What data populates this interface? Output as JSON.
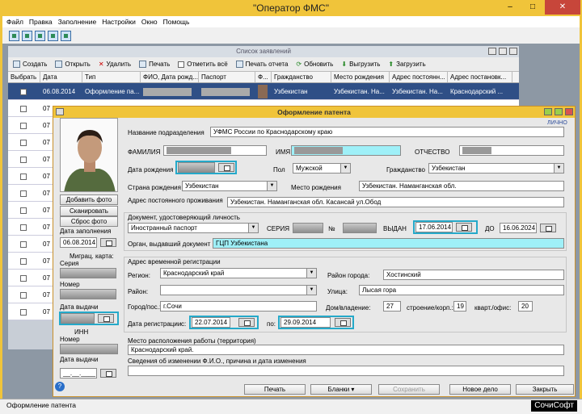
{
  "window": {
    "title": "\"Оператор ФМС\""
  },
  "menu": [
    "Файл",
    "Правка",
    "Заполнение",
    "Настройки",
    "Окно",
    "Помощь"
  ],
  "list_window": {
    "title": "Список заявлений",
    "toolbar": [
      "Создать",
      "Открыть",
      "Удалить",
      "Печать",
      "Отметить всё",
      "Печать отчета",
      "Обновить",
      "Выгрузить",
      "Загрузить"
    ],
    "columns": [
      "Выбрать",
      "Дата",
      "Тип",
      "ФИО, Дата рожд...",
      "Паспорт",
      "Ф...",
      "Гражданство",
      "Место рождения",
      "Адрес постоянн...",
      "Адрес постановк..."
    ],
    "first_row": {
      "date": "06.08.2014",
      "type": "Оформление па...",
      "citizenship": "Узбекистан",
      "birth_place": "Узбекистан. На...",
      "address": "Узбекистан. На...",
      "reg_address": "Краснодарский ..."
    },
    "row_dates": [
      "07",
      "07",
      "07",
      "07",
      "07",
      "07",
      "07",
      "07",
      "07",
      "07",
      "07",
      "07",
      "07"
    ]
  },
  "dialog": {
    "title": "Оформление патента",
    "corner": "ЛИЧНО",
    "left": {
      "add_photo": "Добавить фото",
      "scan": "Сканировать",
      "reset_photo": "Сброс фото",
      "fill_date_label": "Дата заполнения",
      "fill_date": "06.08.2014",
      "migr_card": "Миграц. карта:",
      "series": "Серия",
      "number": "Номер",
      "issue_date": "Дата выдачи",
      "inn": "ИНН",
      "inn_number": "Номер",
      "inn_date": "Дата выдачи",
      "date_mask": "__.__.____"
    },
    "dept_label": "Название подразделения",
    "dept": "УФМС России по Краснодарскому краю",
    "surname_label": "ФАМИЛИЯ",
    "name_label": "ИМЯ",
    "patronymic_label": "ОТЧЕСТВО",
    "birth_date_label": "Дата рождения",
    "sex_label": "Пол",
    "sex": "Мужской",
    "citizenship_label": "Гражданство",
    "citizenship": "Узбекистан",
    "birth_country_label": "Страна рождения",
    "birth_country": "Узбекистан",
    "birth_place_label": "Место рождения",
    "birth_place": "Узбекистан. Наманганская обл.",
    "address_label": "Адрес постоянного проживания",
    "address": "Узбекистан. Наманганская обл. Касансай ул.Обод",
    "doc_section": "Документ, удостоверяющий личность",
    "doc_type": "Иностранный паспорт",
    "series_label": "СЕРИЯ",
    "num_label": "№",
    "issued_label": "ВЫДАН",
    "issued_date": "17.06.2014",
    "to_label": "ДО",
    "to_date": "16.06.2024",
    "authority_label": "Орган, выдавший документ",
    "authority": "ГЦП Узбекистана",
    "temp_section": "Адрес временной регистрации",
    "region_label": "Регион:",
    "region": "Краснодарский край",
    "city_district_label": "Район города:",
    "city_district": "Хостинский",
    "district_label": "Район:",
    "street_label": "Улица:",
    "street": "Лысая гора",
    "city_label": "Город/пос.:",
    "city": "г.Сочи",
    "house_label": "Дом/владение:",
    "house": "27",
    "building_label": "строение/корп.:",
    "building": "19",
    "flat_label": "кварт./офис:",
    "flat": "20",
    "reg_date_label": "Дата регистрации",
    "from_label": "с:",
    "from_date": "22.07.2014",
    "till_label": "по:",
    "till_date": "29.09.2014",
    "work_label": "Место расположения работы (территория)",
    "work": "Краснодарский край.",
    "changes_label": "Сведения об изменении Ф.И.О., причина и дата изменения",
    "buttons": {
      "print": "Печать",
      "forms": "Бланки ▾",
      "save": "Сохранить",
      "new_case": "Новое дело",
      "close": "Закрыть"
    }
  },
  "status": "Оформление патента",
  "watermark": "СочиСофт"
}
